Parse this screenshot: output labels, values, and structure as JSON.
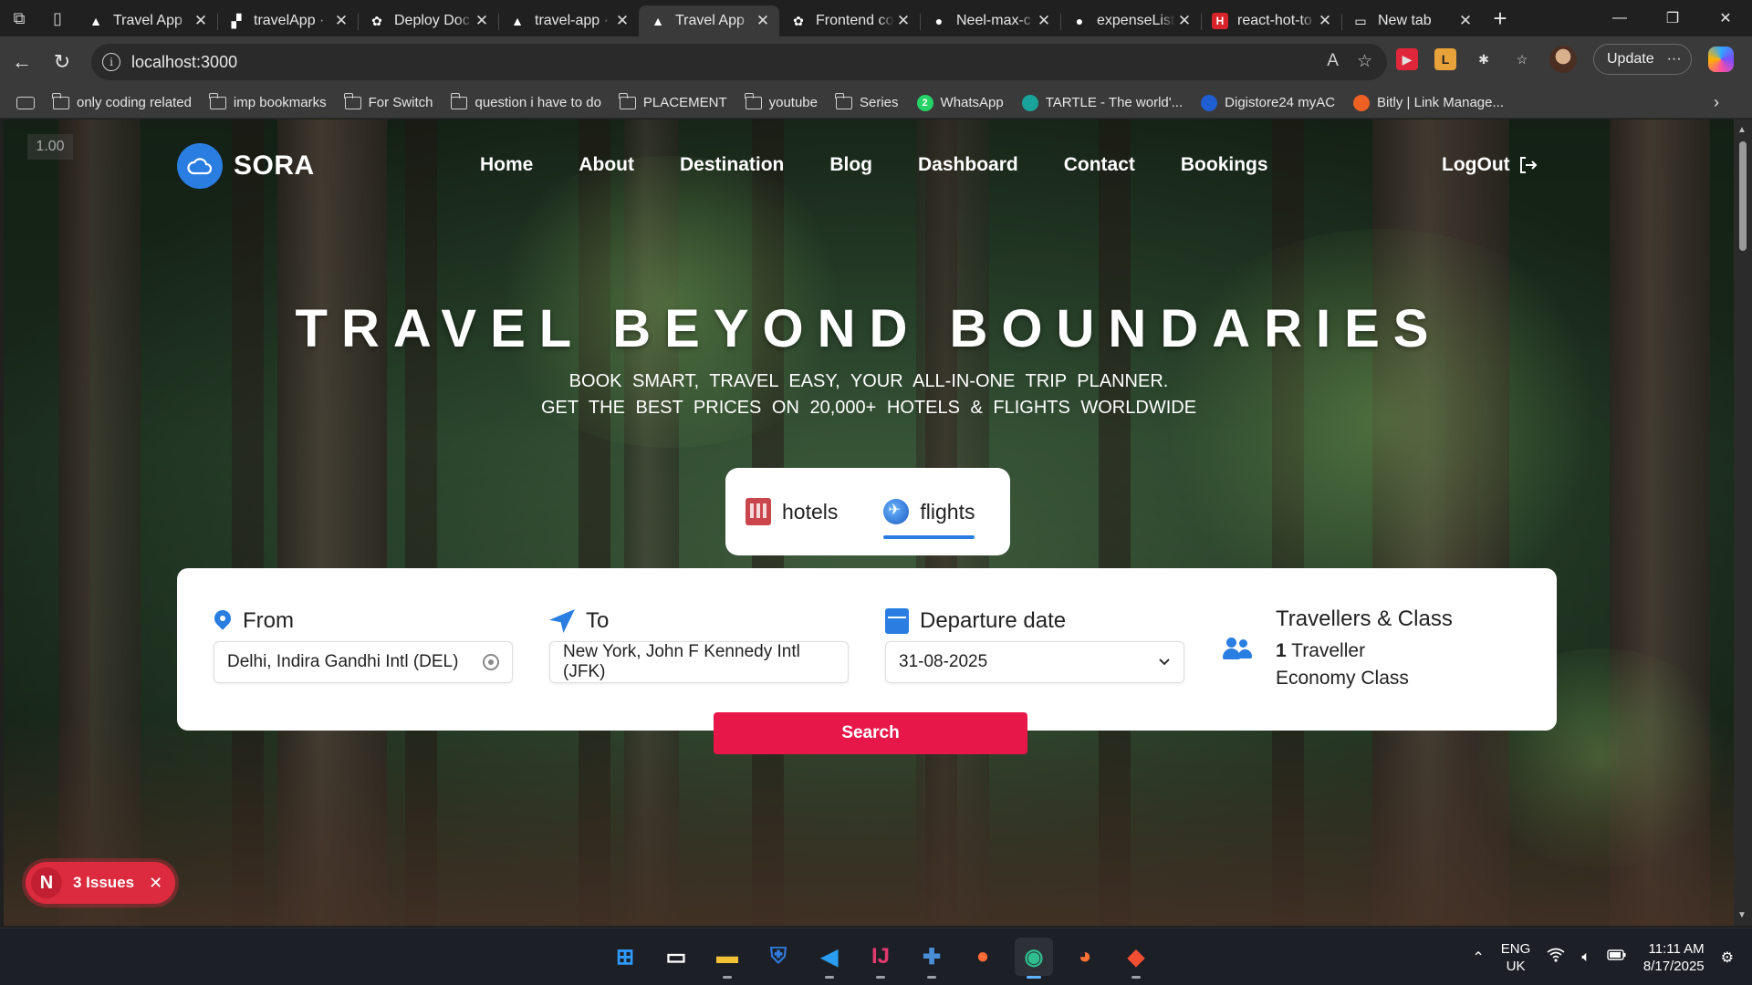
{
  "browser": {
    "tabs": [
      {
        "title": "Travel App",
        "icon": "vercel-triangle-icon",
        "active": false
      },
      {
        "title": "travelApp · ",
        "icon": "render-icon",
        "active": false
      },
      {
        "title": "Deploy Doc",
        "icon": "openai-icon",
        "active": false
      },
      {
        "title": "travel-app ·",
        "icon": "vercel-triangle-icon",
        "active": false
      },
      {
        "title": "Travel App",
        "icon": "vercel-triangle-icon",
        "active": true
      },
      {
        "title": "Frontend co",
        "icon": "openai-icon",
        "active": false
      },
      {
        "title": "Neel-max-c",
        "icon": "github-icon",
        "active": false
      },
      {
        "title": "expenseList",
        "icon": "github-icon",
        "active": false
      },
      {
        "title": "react-hot-to",
        "icon": "h-brand-icon",
        "active": false
      },
      {
        "title": "New tab",
        "icon": "newtab-icon",
        "active": false
      }
    ],
    "url": "localhost:3000",
    "update_label": "Update",
    "bookmarks": [
      {
        "label": "only coding  related",
        "icon": "folder-icon"
      },
      {
        "label": "imp bookmarks",
        "icon": "folder-icon"
      },
      {
        "label": "For Switch",
        "icon": "folder-icon"
      },
      {
        "label": "question i have to do",
        "icon": "folder-icon"
      },
      {
        "label": "PLACEMENT",
        "icon": "folder-icon"
      },
      {
        "label": "youtube",
        "icon": "folder-icon"
      },
      {
        "label": "Series",
        "icon": "folder-icon"
      },
      {
        "label": "WhatsApp",
        "icon": "whatsapp-icon",
        "badge": "2"
      },
      {
        "label": "TARTLE - The world'...",
        "icon": "tartle-icon"
      },
      {
        "label": "Digistore24 myAC",
        "icon": "digistore-icon"
      },
      {
        "label": "Bitly | Link Manage...",
        "icon": "bitly-icon"
      }
    ]
  },
  "page": {
    "zoom_badge": "1.00",
    "brand": "SORA",
    "nav": [
      "Home",
      "About",
      "Destination",
      "Blog",
      "Dashboard",
      "Contact",
      "Bookings"
    ],
    "logout_label": "LogOut",
    "hero_title": "TRAVEL BEYOND BOUNDARIES",
    "hero_sub1": "BOOK SMART, TRAVEL EASY, YOUR ALL-IN-ONE TRIP PLANNER.",
    "hero_sub2": "GET THE BEST PRICES ON 20,000+ HOTELS & FLIGHTS WORLDWIDE",
    "mode_tabs": [
      {
        "label": "hotels",
        "active": false
      },
      {
        "label": "flights",
        "active": true
      }
    ],
    "search": {
      "from_label": "From",
      "from_value": "Delhi, Indira Gandhi Intl (DEL)",
      "to_label": "To",
      "to_value": "New York, John F Kennedy Intl (JFK)",
      "date_label": "Departure date",
      "date_value": "31-08-2025",
      "travellers_label": "Travellers & Class",
      "traveller_count": "1",
      "traveller_word": "Traveller",
      "class_value": "Economy Class",
      "button": "Search"
    },
    "issues": {
      "letter": "N",
      "label": "3 Issues"
    }
  },
  "taskbar": {
    "apps": [
      "windows-start-icon",
      "widgets-icon",
      "file-explorer-icon",
      "azure-data-icon",
      "vscode-icon",
      "intellij-icon",
      "tableau-icon",
      "postman-icon",
      "edge-icon",
      "firefox-icon",
      "git-icon"
    ],
    "lang_line1": "ENG",
    "lang_line2": "UK",
    "time": "11:11 AM",
    "date": "8/17/2025"
  },
  "colors": {
    "brand_blue": "#2a7de1",
    "search_red": "#e8174a",
    "issues_red": "#dc2b3e"
  }
}
